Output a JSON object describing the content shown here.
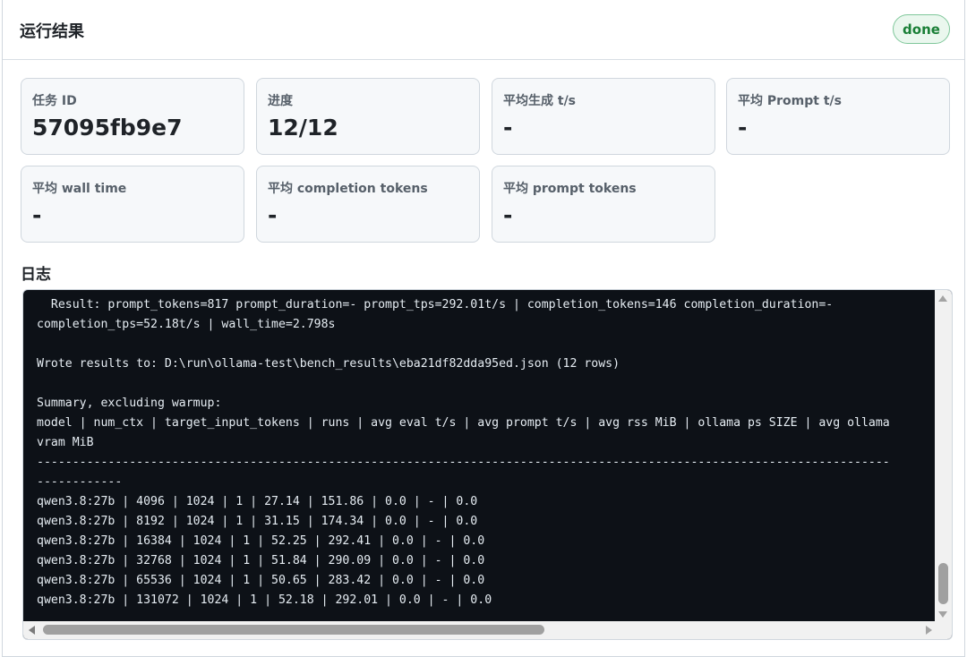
{
  "panel": {
    "title": "运行结果",
    "status": "done",
    "status_color": "#1a7f37"
  },
  "stats": [
    {
      "label": "任务 ID",
      "value": "57095fb9e7"
    },
    {
      "label": "进度",
      "value": "12/12"
    },
    {
      "label": "平均生成 t/s",
      "value": "-"
    },
    {
      "label": "平均 Prompt t/s",
      "value": "-"
    },
    {
      "label": "平均 wall time",
      "value": "-"
    },
    {
      "label": "平均 completion tokens",
      "value": "-"
    },
    {
      "label": "平均 prompt tokens",
      "value": "-"
    }
  ],
  "log": {
    "heading": "日志",
    "lines": [
      "  Result: prompt_tokens=817 prompt_duration=- prompt_tps=292.01t/s | completion_tokens=146 completion_duration=-",
      "completion_tps=52.18t/s | wall_time=2.798s",
      "",
      "Wrote results to: D:\\run\\ollama-test\\bench_results\\eba21df82dda95ed.json (12 rows)",
      "",
      "Summary, excluding warmup:",
      "model | num_ctx | target_input_tokens | runs | avg eval t/s | avg prompt t/s | avg rss MiB | ollama ps SIZE | avg ollama",
      "vram MiB",
      "------------------------------------------------------------------------------------------------------------------------",
      "------------",
      "qwen3.8:27b | 4096 | 1024 | 1 | 27.14 | 151.86 | 0.0 | - | 0.0",
      "qwen3.8:27b | 8192 | 1024 | 1 | 31.15 | 174.34 | 0.0 | - | 0.0",
      "qwen3.8:27b | 16384 | 1024 | 1 | 52.25 | 292.41 | 0.0 | - | 0.0",
      "qwen3.8:27b | 32768 | 1024 | 1 | 51.84 | 290.09 | 0.0 | - | 0.0",
      "qwen3.8:27b | 65536 | 1024 | 1 | 50.65 | 283.42 | 0.0 | - | 0.0",
      "qwen3.8:27b | 131072 | 1024 | 1 | 52.18 | 292.01 | 0.0 | - | 0.0"
    ]
  }
}
